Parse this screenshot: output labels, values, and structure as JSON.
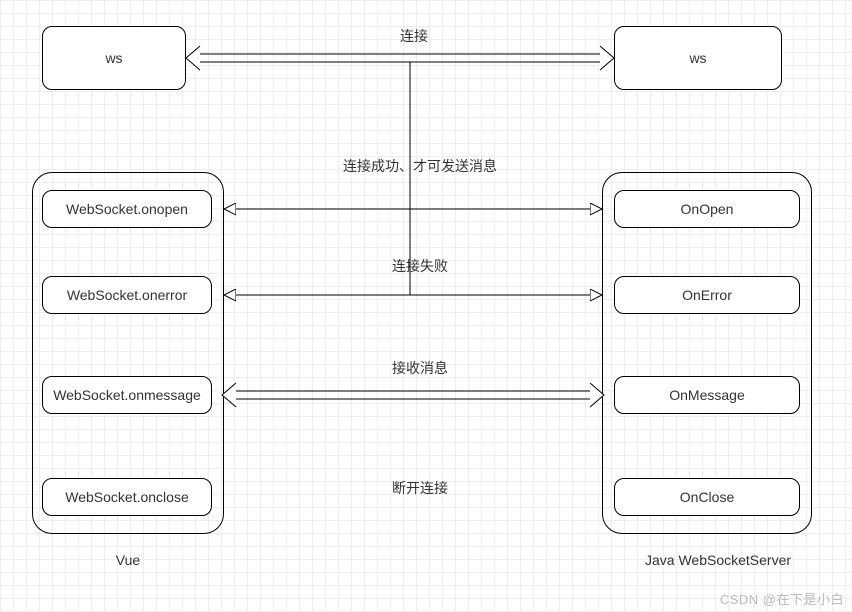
{
  "top": {
    "left_ws": "ws",
    "right_ws": "ws",
    "connect_label": "连接"
  },
  "mid_labels": {
    "success": "连接成功、才可发送消息",
    "fail": "连接失败",
    "receive": "接收消息",
    "disconnect": "断开连接"
  },
  "left": {
    "title": "Vue",
    "onopen": "WebSocket.onopen",
    "onerror": "WebSocket.onerror",
    "onmessage": "WebSocket.onmessage",
    "onclose": "WebSocket.onclose"
  },
  "right": {
    "title": "Java WebSocketServer",
    "onopen": "OnOpen",
    "onerror": "OnError",
    "onmessage": "OnMessage",
    "onclose": "OnClose"
  },
  "watermark": "CSDN @在下是小白"
}
